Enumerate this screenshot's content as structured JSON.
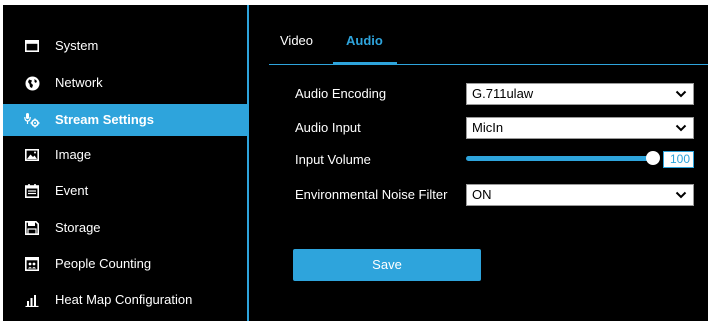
{
  "sidebar": {
    "items": [
      {
        "label": "System",
        "icon": "window-icon",
        "active": false
      },
      {
        "label": "Network",
        "icon": "globe-icon",
        "active": false
      },
      {
        "label": "Stream Settings",
        "icon": "stream-settings-icon",
        "active": true
      },
      {
        "label": "Image",
        "icon": "image-icon",
        "active": false
      },
      {
        "label": "Event",
        "icon": "calendar-icon",
        "active": false
      },
      {
        "label": "Storage",
        "icon": "save-disk-icon",
        "active": false
      },
      {
        "label": "People Counting",
        "icon": "people-counting-icon",
        "active": false
      },
      {
        "label": "Heat Map Configuration",
        "icon": "bar-chart-icon",
        "active": false
      }
    ]
  },
  "tabs": [
    {
      "label": "Video",
      "active": false
    },
    {
      "label": "Audio",
      "active": true
    }
  ],
  "form": {
    "audio_encoding": {
      "label": "Audio Encoding",
      "value": "G.711ulaw"
    },
    "audio_input": {
      "label": "Audio Input",
      "value": "MicIn"
    },
    "input_volume": {
      "label": "Input Volume",
      "value": "100",
      "max": 100
    },
    "noise_filter": {
      "label": "Environmental Noise Filter",
      "value": "ON"
    }
  },
  "save_label": "Save",
  "colors": {
    "accent": "#2ea4dc",
    "background": "#000000",
    "text": "#ffffff"
  }
}
